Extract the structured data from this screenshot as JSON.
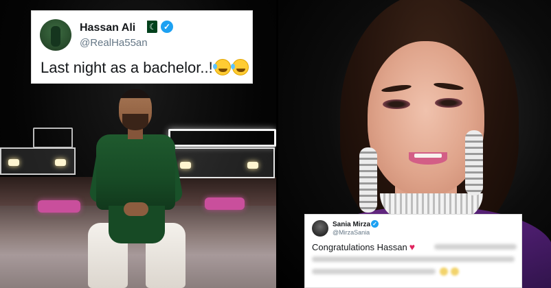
{
  "tweet_hassan": {
    "name": "Hassan Ali",
    "handle": "@RealHa55an",
    "text": "Last night as a bachelor..!",
    "emoji_count": 2,
    "flag_icon": "pakistan-flag-icon",
    "verified_icon": "verified-badge-icon"
  },
  "tweet_sania": {
    "name": "Sania Mirza",
    "handle": "@MirzaSania",
    "text": "Congratulations Hassan",
    "heart_icon": "red-heart-icon",
    "verified_icon": "verified-badge-icon"
  },
  "colors": {
    "verified_blue": "#1da1f2",
    "heart_red": "#e0245e",
    "text_dark": "#14171a",
    "handle_gray": "#657786"
  }
}
